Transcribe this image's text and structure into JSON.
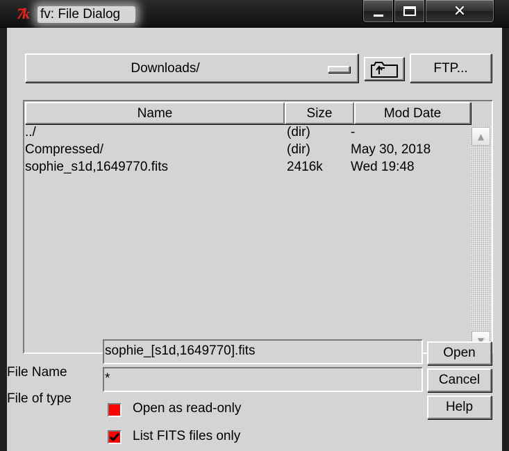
{
  "window": {
    "title": "fv: File Dialog",
    "logo_text": "7k",
    "controls": {
      "minimize": "minimize-icon",
      "maximize": "maximize-icon",
      "close": "✕"
    }
  },
  "toolbar": {
    "directory": "Downloads/",
    "up_icon": "folder-up-icon",
    "ftp_label": "FTP..."
  },
  "file_list": {
    "columns": [
      "Name",
      "Size",
      "Mod Date"
    ],
    "rows": [
      {
        "name": "../",
        "size": "(dir)",
        "date": "-"
      },
      {
        "name": "Compressed/",
        "size": "(dir)",
        "date": "May 30, 2018"
      },
      {
        "name": "sophie_s1d,1649770.fits",
        "size": "2416k",
        "date": "Wed  19:48"
      }
    ]
  },
  "form": {
    "file_name_label": "File Name",
    "file_name_value": "sophie_[s1d,1649770].fits",
    "file_type_label": "File of type",
    "file_type_value": "*"
  },
  "buttons": {
    "open": "Open",
    "cancel": "Cancel",
    "help": "Help"
  },
  "options": {
    "read_only_label": "Open as read-only",
    "read_only_checked": false,
    "list_fits_label": "List FITS files only",
    "list_fits_checked": true
  },
  "colors": {
    "checkbox_fill": "#ff0000",
    "background": "#d4d4d4",
    "logo": "#e8231e"
  }
}
